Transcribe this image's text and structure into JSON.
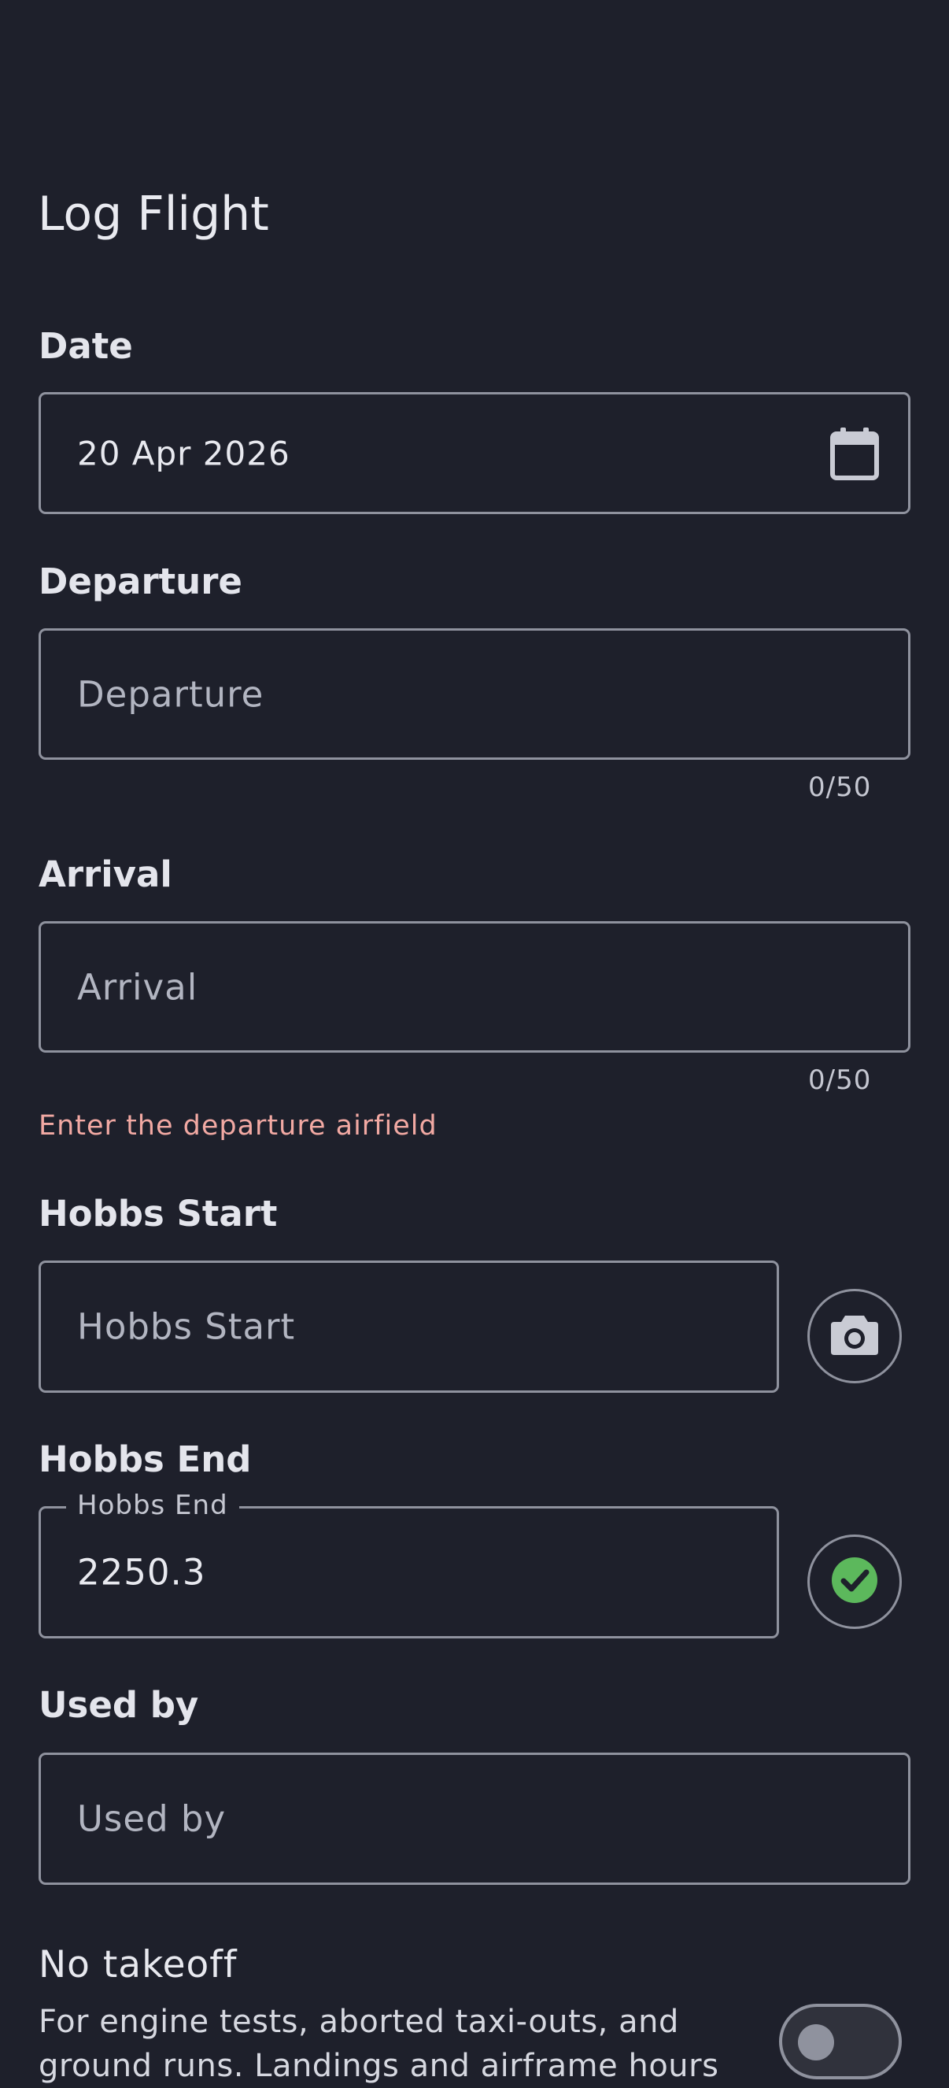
{
  "header": {
    "title": "Log Flight"
  },
  "form": {
    "date": {
      "label": "Date",
      "value": "20 Apr 2026"
    },
    "departure": {
      "label": "Departure",
      "placeholder": "Departure",
      "counter": "0/50"
    },
    "arrival": {
      "label": "Arrival",
      "placeholder": "Arrival",
      "counter": "0/50"
    },
    "error": "Enter the departure airfield",
    "hobbs_start": {
      "label": "Hobbs Start",
      "placeholder": "Hobbs Start"
    },
    "hobbs_end": {
      "label": "Hobbs End",
      "floating_label": "Hobbs End",
      "value": "2250.3"
    },
    "used_by": {
      "label": "Used by",
      "placeholder": "Used by"
    },
    "no_takeoff": {
      "title": "No takeoff",
      "description": "For engine tests, aborted taxi-outs, and ground runs. Landings and airframe hours",
      "enabled": false
    }
  },
  "icons": {
    "date_picker": "calendar-icon",
    "hobbs_start_action": "camera-icon",
    "hobbs_end_status": "check-circle-icon"
  },
  "colors": {
    "background": "#1e202b",
    "outline": "#8f929e",
    "error": "#f2a9a3",
    "success": "#5cb85c"
  }
}
